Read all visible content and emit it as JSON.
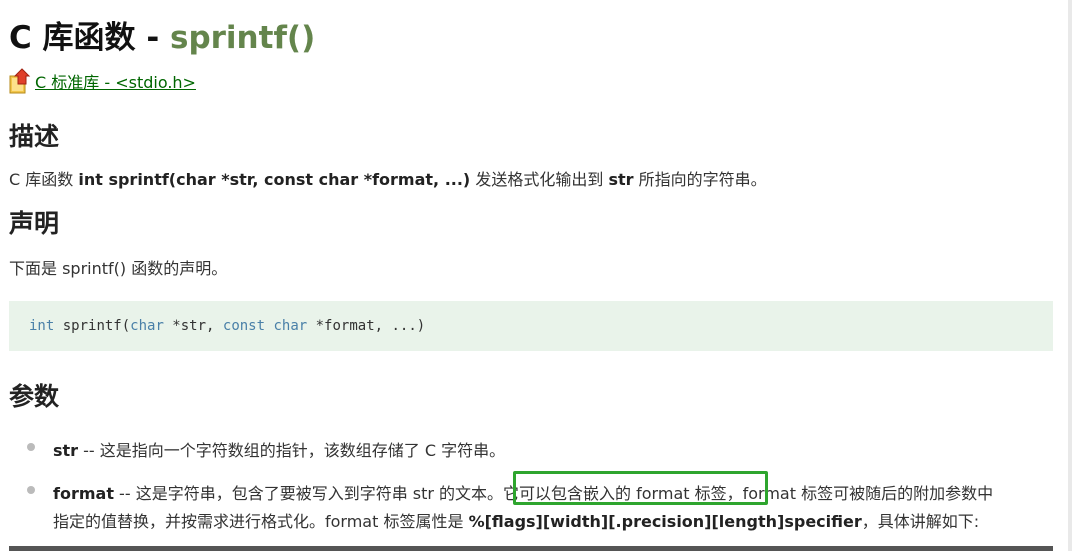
{
  "title": {
    "prefix": "C 库函数 - ",
    "fn": "sprintf()"
  },
  "back_link": {
    "icon": "back-arrow-icon",
    "label": " C 标准库 - <stdio.h>"
  },
  "sections": {
    "desc_heading": "描述",
    "desc": {
      "t1": "C 库函数 ",
      "b1": "int sprintf(char *str, const char *format, ...)",
      "t2": " 发送格式化输出到 ",
      "b2": "str",
      "t3": " 所指向的字符串。"
    },
    "decl_heading": "声明",
    "decl_text": "下面是 sprintf() 函数的声明。",
    "code": {
      "kw1": "int",
      "t1": " sprintf(",
      "kw2": "char",
      "t2": " *str, ",
      "kw3": "const",
      "t3": " ",
      "kw4": "char",
      "t4": " *format, ...)"
    },
    "params_heading": "参数",
    "params": {
      "p1": {
        "name": "str",
        "text": " -- 这是指向一个字符数组的指针，该数组存储了 C 字符串。"
      },
      "p2": {
        "name": "format",
        "line1": " -- 这是字符串，包含了要被写入到字符串 str 的文本。它可以包含嵌入的 format 标签，format 标签可被随后的附加参数中",
        "line2a": "指定的值替换，并按需求进行格式化。format 标签属性是 ",
        "line2b": "%[flags][width][.precision][length]specifier",
        "line2c": "，具体讲解如下:"
      }
    }
  },
  "colors": {
    "fn": "#64854c",
    "link": "#006600",
    "code_bg": "#e9f3ea",
    "keyword": "#4a80a8",
    "highlight": "#2ea52e"
  }
}
